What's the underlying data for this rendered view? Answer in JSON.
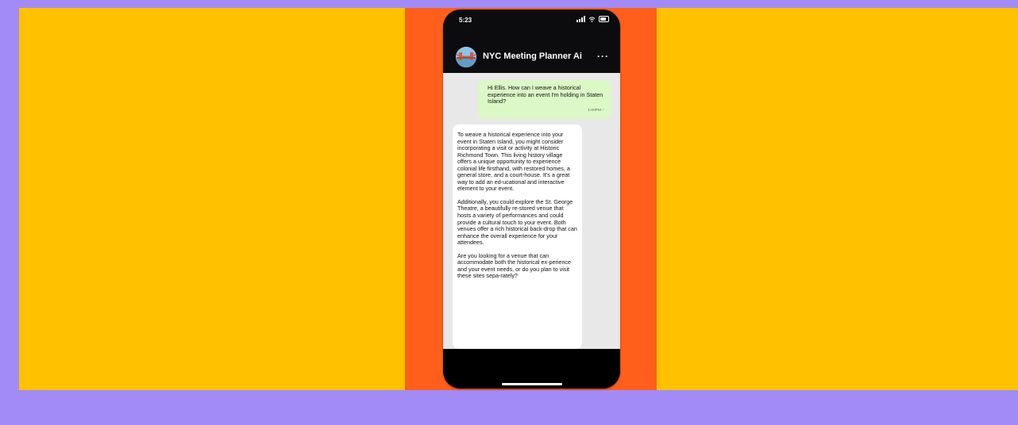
{
  "colors": {
    "outer_background": "#a38bf7",
    "stage_background": "#ffc100",
    "phone_backdrop": "#ff5f1b",
    "phone_frame": "#0c0c0f",
    "chat_background": "#e8e8e9",
    "user_bubble": "#dcf8c6",
    "bot_bubble": "#ffffff"
  },
  "status_bar": {
    "time": "5:23",
    "icons": [
      "signal-icon",
      "wifi-icon",
      "battery-icon"
    ]
  },
  "chat_header": {
    "title": "NYC Meeting Planner Ai",
    "more": "···",
    "avatar_icon": "bridge-avatar-icon"
  },
  "messages": {
    "user": {
      "text": "Hi Ellis. How can I weave a historical experience into an event I'm holding in Staten Island?",
      "time": "1:00PM",
      "check": "✓"
    },
    "bot": {
      "paragraphs": [
        "To weave a historical experience into your event in Staten Island, you might consider incorporating a visit or activity at Historic Richmond Town. This living history village offers a unique opportunity to experience colonial life firsthand, with restored homes, a general store, and a court-house. It's a great way to add an ed-ucational and interactive element to your event.",
        "Additionally, you could explore the St. George Theatre, a beautifully re-stored venue that hosts a variety of performances and could provide a cultural touch to your event. Both venues offer a rich historical back-drop that can enhance the overall experience for your attendees.",
        "Are you looking for a venue that can accommodate both the historical ex-perience and your event needs, or do you plan to visit these sites sepa-rately?"
      ]
    }
  }
}
